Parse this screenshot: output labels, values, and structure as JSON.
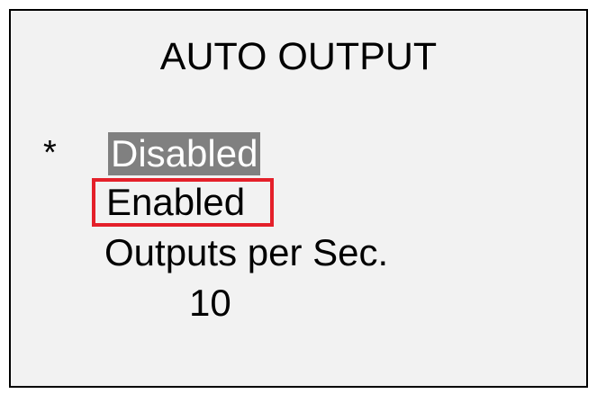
{
  "screen": {
    "title": "AUTO OUTPUT",
    "selection_marker": "*",
    "options": {
      "disabled": "Disabled",
      "enabled": "Enabled",
      "outputs_per_sec": "Outputs per Sec."
    },
    "outputs_per_sec_value": "10"
  },
  "colors": {
    "background": "#f2f2f2",
    "border": "#000000",
    "highlight_background": "#808080",
    "highlight_text": "#ffffff",
    "focus_box": "#e4202a"
  }
}
